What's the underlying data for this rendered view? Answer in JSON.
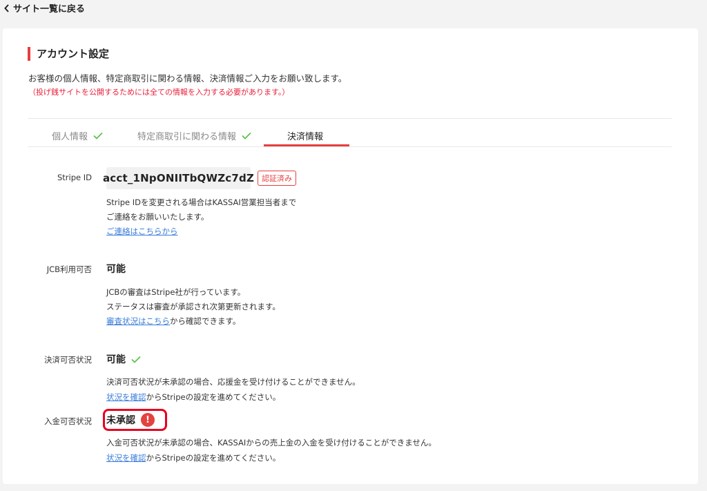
{
  "back": {
    "label": "サイト一覧に戻る"
  },
  "page": {
    "title": "アカウント設定",
    "description": "お客様の個人情報、特定商取引に関わる情報、決済情報ご入力をお願い致します。",
    "note": "（投げ銭サイトを公開するためには全ての情報を入力する必要があります。）"
  },
  "tabs": [
    {
      "label": "個人情報",
      "done": true
    },
    {
      "label": "特定商取引に関わる情報",
      "done": true
    },
    {
      "label": "決済情報",
      "active": true
    }
  ],
  "stripe": {
    "label": "Stripe ID",
    "value": "acct_1NpONIITbQWZc7dZ",
    "badge": "認証済み",
    "help_line1": "Stripe IDを変更される場合はKASSAI営業担当者まで",
    "help_line2": "ご連絡をお願いいたします。",
    "link": "ご連絡はこちらから"
  },
  "jcb": {
    "label": "JCB利用可否",
    "value": "可能",
    "help_line1": "JCBの審査はStripe社が行っています。",
    "help_line2": "ステータスは審査が承認され次第更新されます。",
    "link": "審査状況はこちら",
    "link_suffix": "から確認できます。"
  },
  "payment": {
    "label": "決済可否状況",
    "value": "可能",
    "help_line1": "決済可否状況が未承認の場合、応援金を受け付けることができません。",
    "link": "状況を確認",
    "link_suffix": "からStripeの設定を進めてください。"
  },
  "deposit": {
    "label": "入金可否状況",
    "value": "未承認",
    "alert_glyph": "!",
    "help_line1": "入金可否状況が未承認の場合、KASSAIからの売上金の入金を受け付けることができません。",
    "link": "状況を確認",
    "link_suffix": "からStripeの設定を進めてください。"
  },
  "colors": {
    "accent": "#e63e3e",
    "link": "#3a7dd9",
    "check": "#5cc34a",
    "highlight": "#e8001f"
  }
}
